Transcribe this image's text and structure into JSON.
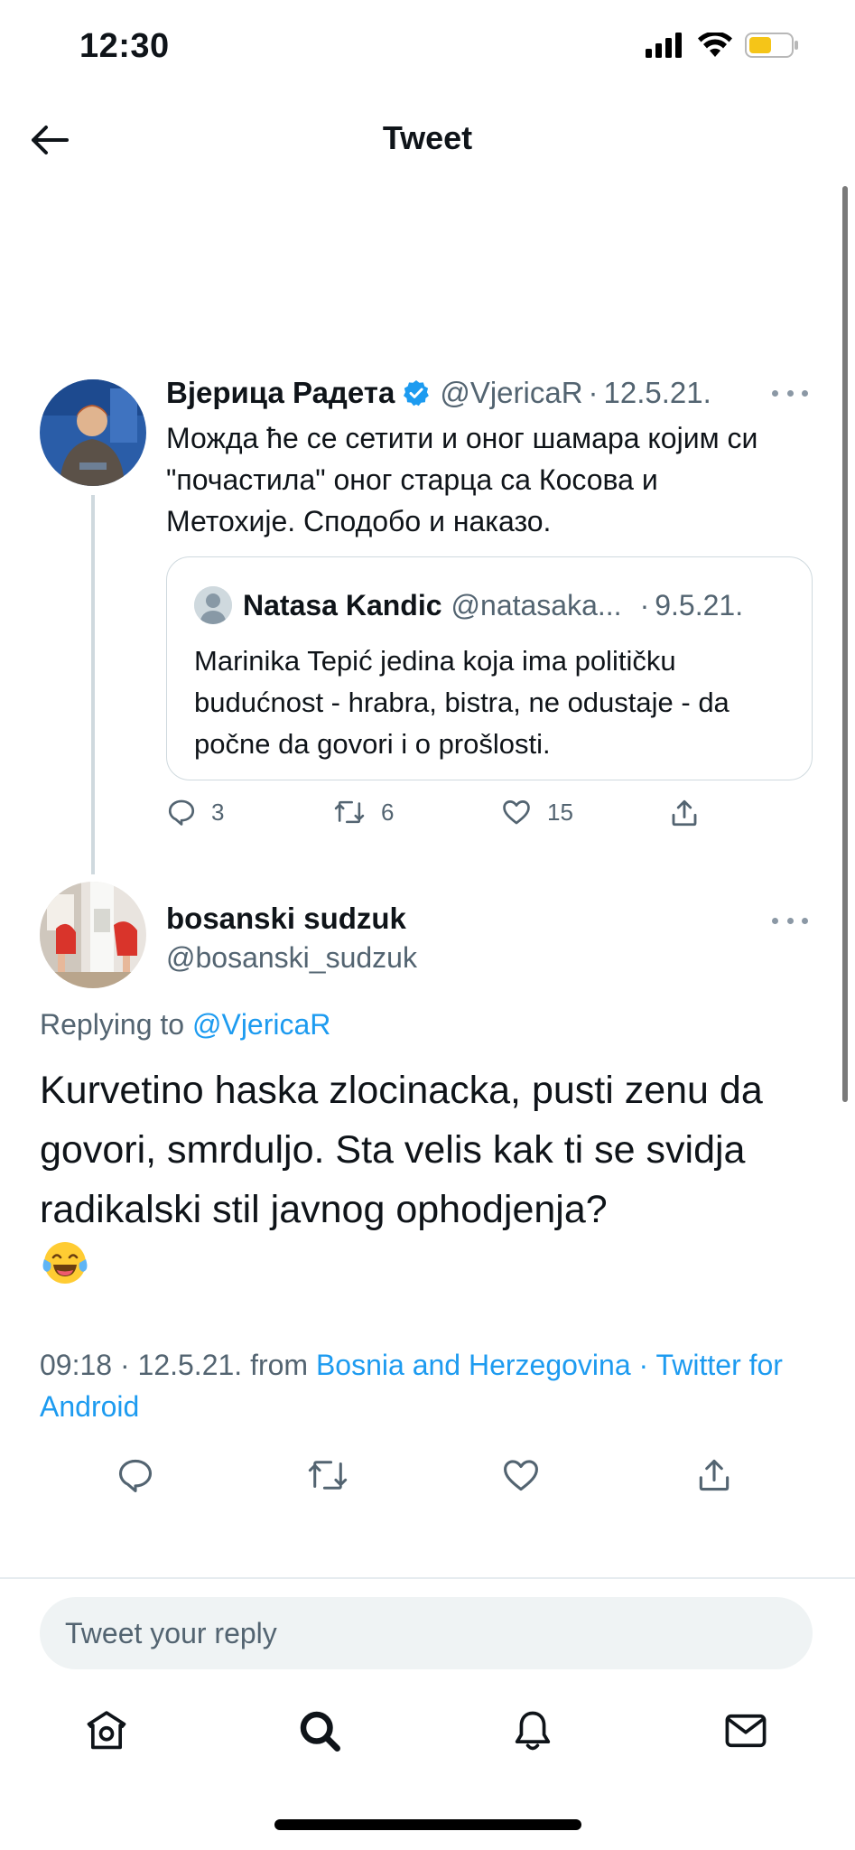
{
  "status_bar": {
    "time": "12:30",
    "battery_color": "#f5c518"
  },
  "header": {
    "title": "Tweet",
    "back_icon": "arrow-left-icon"
  },
  "parent_tweet": {
    "name": "Вјерица Радета",
    "verified": true,
    "handle": "@VjericaR",
    "date": "12.5.21.",
    "text": "Можда ће се сетити и оног шамара којим си \"почастила\" оног старца са Косова и Метохије. Сподобо и наказо.",
    "quote": {
      "name": "Natasa Kandic",
      "handle": "@natasaka...",
      "date": "9.5.21.",
      "text": "Marinika Tepić jedina koja ima političku budućnost - hrabra, bistra, ne odustaje - da počne da govori i o prošlosti."
    },
    "actions": {
      "replies": "3",
      "retweets": "6",
      "likes": "15"
    }
  },
  "main_tweet": {
    "name": "bosanski sudzuk",
    "handle": "@bosanski_sudzuk",
    "replying_prefix": "Replying to",
    "replying_to": "@VjericaR",
    "text": "Kurvetino haska zlocinacka, pusti zenu da govori, smrduljo. Sta velis kak ti se svidja radikalski stil javnog ophodjenja?",
    "emoji": "face-with-tears-of-joy",
    "time": "09:18",
    "date": "12.5.21.",
    "from_label": "from",
    "location": "Bosnia and Herzegovina",
    "client": "Twitter for Android"
  },
  "reply_box": {
    "placeholder": "Tweet your reply"
  },
  "tabbar": {
    "items": [
      "home-icon",
      "search-icon",
      "notifications-icon",
      "messages-icon"
    ]
  },
  "colors": {
    "accent": "#1d9bf0",
    "muted": "#536471",
    "text": "#0f1419"
  }
}
